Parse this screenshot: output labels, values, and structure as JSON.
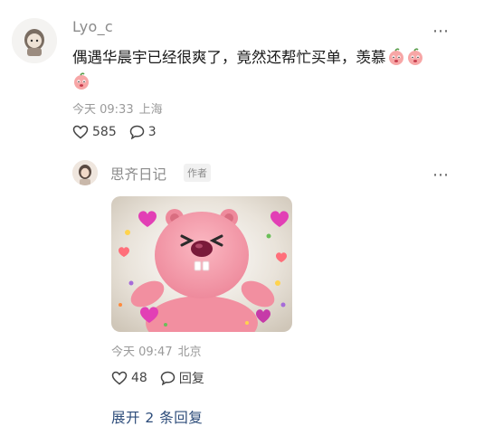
{
  "comment": {
    "username": "Lyo_c",
    "text": "偶遇华晨宇已经很爽了，竟然还帮忙买单，羡慕",
    "emoji_name": "peach-crying-emoji",
    "time": "今天 09:33",
    "location": "上海",
    "likes": "585",
    "replies": "3"
  },
  "reply": {
    "username": "思齐日记",
    "badge": "作者",
    "sticker_name": "pink-beaver-heart-sticker",
    "time": "今天 09:47",
    "location": "北京",
    "likes": "48",
    "reply_label": "回复"
  },
  "expand_replies": "展开 2 条回复",
  "colors": {
    "link": "#2d4c7a",
    "meta": "#9a9a9a",
    "sticker_pink": "#f28fa0"
  }
}
